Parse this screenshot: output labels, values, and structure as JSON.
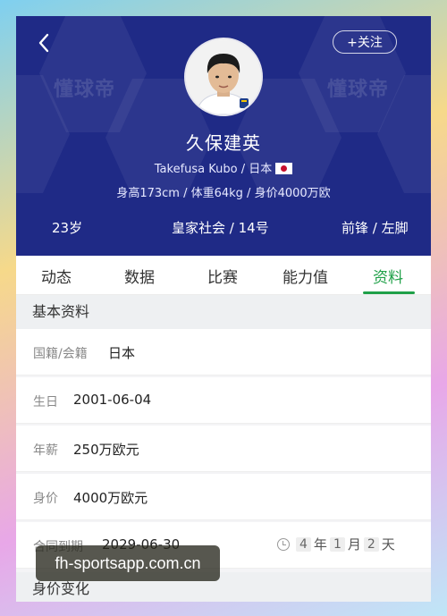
{
  "header": {
    "watermark_text": "懂球帝",
    "follow_label": "+关注",
    "player_name": "久保建英",
    "english_name_nation": "Takefusa Kubo / 日本",
    "physical": "身高173cm / 体重64kg / 身价4000万欧",
    "age": "23岁",
    "club_number": "皇家社会 / 14号",
    "position_foot": "前锋 / 左脚",
    "bg_color": "#1f2a86",
    "back_icon": "chevron-left-icon",
    "flag_icon": "japan-flag-icon"
  },
  "tabs": [
    {
      "label": "动态"
    },
    {
      "label": "数据"
    },
    {
      "label": "比赛"
    },
    {
      "label": "能力值"
    },
    {
      "label": "资料"
    }
  ],
  "active_tab": "资料",
  "accent_color": "#1fa048",
  "basic_info": {
    "title": "基本资料",
    "rows": [
      {
        "label": "国籍/会籍",
        "value": "日本"
      },
      {
        "label": "生日",
        "value": "2001-06-04"
      },
      {
        "label": "年薪",
        "value": "250万欧元"
      },
      {
        "label": "身价",
        "value": "4000万欧元"
      },
      {
        "label": "合同到期",
        "value": "2029-06-30"
      }
    ],
    "countdown": {
      "years": "4",
      "year_unit": "年",
      "months": "1",
      "month_unit": "月",
      "days": "2",
      "day_unit": "天"
    }
  },
  "value_change": {
    "title": "身价变化"
  },
  "site_watermark": "fh-sportsapp.com.cn"
}
